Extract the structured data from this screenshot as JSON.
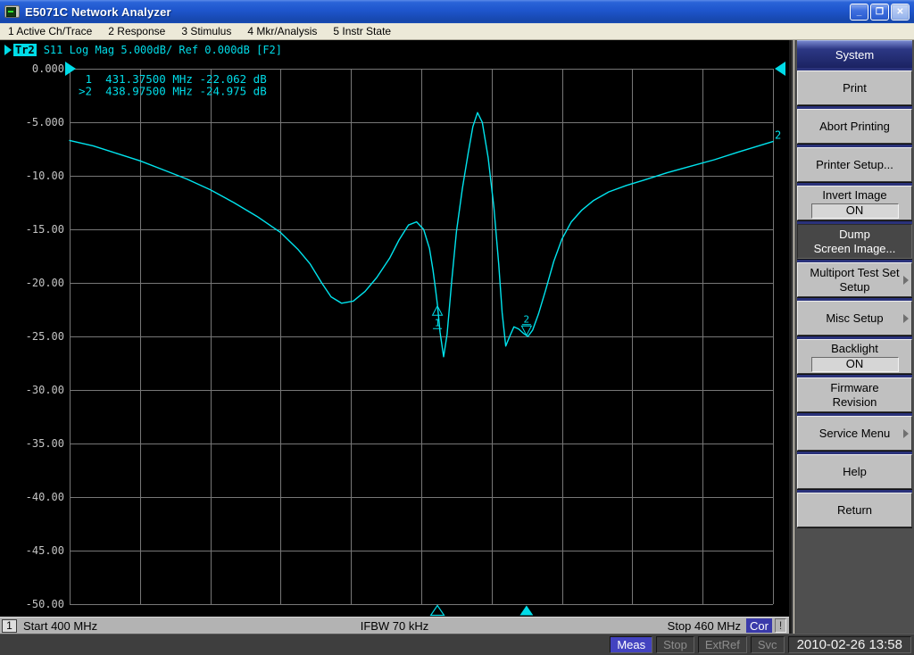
{
  "window": {
    "title": "E5071C Network Analyzer",
    "buttons": [
      {
        "name": "minimize",
        "glyph": "_"
      },
      {
        "name": "restore",
        "glyph": "❐"
      },
      {
        "name": "close",
        "glyph": "✕"
      }
    ]
  },
  "menubar": {
    "items": [
      "1 Active Ch/Trace",
      "2 Response",
      "3 Stimulus",
      "4 Mkr/Analysis",
      "5 Instr State"
    ]
  },
  "trace_header": {
    "chip": "Tr2",
    "text": "S11 Log Mag 5.000dB/ Ref 0.000dB [F2]"
  },
  "chart_data": {
    "type": "line",
    "title": "Tr2 S11 Log Mag 5.000dB/ Ref 0.000dB [F2]",
    "x_axis": {
      "start_mhz": 400,
      "stop_mhz": 460,
      "start_label": "Start 400 MHz",
      "stop_label": "Stop 460 MHz"
    },
    "y_axis": {
      "top_db": 0,
      "bottom_db": -50,
      "db_per_div": 5,
      "ref_level_db": 0,
      "tick_labels": [
        "0.000",
        "-5.000",
        "-10.00",
        "-15.00",
        "-20.00",
        "-25.00",
        "-30.00",
        "-35.00",
        "-40.00",
        "-45.00",
        "-50.00"
      ]
    },
    "grid": {
      "x_divisions": 10,
      "y_divisions": 10,
      "on": true
    },
    "series": [
      {
        "name": "S11",
        "color": "#00e4ee",
        "trace_end_label": "2",
        "points_mhz_db": [
          [
            400.0,
            -6.7
          ],
          [
            402,
            -7.2
          ],
          [
            404,
            -7.9
          ],
          [
            406,
            -8.6
          ],
          [
            408,
            -9.45
          ],
          [
            410,
            -10.3
          ],
          [
            412,
            -11.3
          ],
          [
            414,
            -12.5
          ],
          [
            416,
            -13.8
          ],
          [
            418,
            -15.3
          ],
          [
            419.5,
            -16.9
          ],
          [
            420.5,
            -18.2
          ],
          [
            421.5,
            -20.0
          ],
          [
            422.3,
            -21.3
          ],
          [
            423.2,
            -21.9
          ],
          [
            424.2,
            -21.7
          ],
          [
            425.2,
            -20.8
          ],
          [
            426.2,
            -19.5
          ],
          [
            427.3,
            -17.7
          ],
          [
            428.1,
            -16.0
          ],
          [
            428.9,
            -14.6
          ],
          [
            429.6,
            -14.3
          ],
          [
            430.2,
            -15.0
          ],
          [
            430.7,
            -16.8
          ],
          [
            431.0,
            -18.8
          ],
          [
            431.2,
            -20.5
          ],
          [
            431.375,
            -22.062
          ],
          [
            431.6,
            -24.6
          ],
          [
            431.9,
            -26.9
          ],
          [
            432.2,
            -24.8
          ],
          [
            432.6,
            -19.8
          ],
          [
            433.0,
            -15.2
          ],
          [
            433.5,
            -11.2
          ],
          [
            434.0,
            -7.9
          ],
          [
            434.4,
            -5.4
          ],
          [
            434.8,
            -4.1
          ],
          [
            435.2,
            -5.0
          ],
          [
            435.7,
            -8.3
          ],
          [
            436.2,
            -13.0
          ],
          [
            436.6,
            -18.2
          ],
          [
            436.9,
            -22.8
          ],
          [
            437.2,
            -25.9
          ],
          [
            437.5,
            -25.1
          ],
          [
            437.9,
            -24.1
          ],
          [
            438.3,
            -24.3
          ],
          [
            438.7,
            -24.7
          ],
          [
            439.1,
            -25.0
          ],
          [
            439.5,
            -24.4
          ],
          [
            440.0,
            -22.9
          ],
          [
            440.6,
            -20.7
          ],
          [
            441.3,
            -18.0
          ],
          [
            442.0,
            -15.9
          ],
          [
            442.8,
            -14.3
          ],
          [
            443.7,
            -13.2
          ],
          [
            444.7,
            -12.3
          ],
          [
            446.0,
            -11.5
          ],
          [
            447.5,
            -10.9
          ],
          [
            449.0,
            -10.4
          ],
          [
            451.0,
            -9.7
          ],
          [
            453.0,
            -9.1
          ],
          [
            455.0,
            -8.5
          ],
          [
            457.0,
            -7.8
          ],
          [
            458.5,
            -7.3
          ],
          [
            460.0,
            -6.8
          ]
        ]
      }
    ],
    "markers": [
      {
        "num": "1",
        "freq_mhz": 431.375,
        "value_db": -22.062,
        "active": false,
        "glyph": "triangle-up-below-point",
        "readout": " 1  431.37500 MHz -22.062 dB"
      },
      {
        "num": "2",
        "freq_mhz": 438.975,
        "value_db": -24.975,
        "active": true,
        "glyph": "triangle-down-above-point",
        "readout": ">2  438.97500 MHz -24.975 dB"
      }
    ],
    "colors": {
      "trace": "#00e4ee",
      "grid": "#777777",
      "tick_text": "#c4c4c4",
      "marker_text": "#00dce8"
    }
  },
  "channel_bar": {
    "channel": "1",
    "start": "Start 400 MHz",
    "ifbw": "IFBW 70 kHz",
    "stop": "Stop 460 MHz",
    "cor": "Cor",
    "warning": "!"
  },
  "softkeys": {
    "header": "System",
    "buttons": [
      {
        "lines": [
          "Print"
        ]
      },
      {
        "lines": [
          "Abort Printing"
        ]
      },
      {
        "lines": [
          "Printer Setup..."
        ]
      },
      {
        "lines": [
          "Invert Image"
        ],
        "toggle": "ON"
      },
      {
        "lines": [
          "Dump",
          "Screen Image..."
        ],
        "active": true
      },
      {
        "lines": [
          "Multiport Test Set",
          "Setup"
        ],
        "arrow": true
      },
      {
        "lines": [
          "Misc Setup"
        ],
        "arrow": true
      },
      {
        "lines": [
          "Backlight"
        ],
        "toggle": "ON"
      },
      {
        "lines": [
          "Firmware",
          "Revision"
        ]
      },
      {
        "lines": [
          "Service Menu"
        ],
        "arrow": true
      },
      {
        "lines": [
          "Help"
        ]
      },
      {
        "lines": [
          "Return"
        ]
      }
    ]
  },
  "statusbar": {
    "items": [
      {
        "label": "Meas",
        "active": true
      },
      {
        "label": "Stop",
        "active": false
      },
      {
        "label": "ExtRef",
        "active": false
      },
      {
        "label": "Svc",
        "active": false
      }
    ],
    "datetime": "2010-02-26 13:58"
  }
}
